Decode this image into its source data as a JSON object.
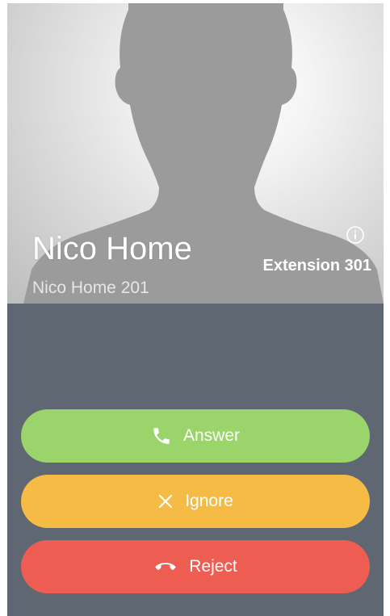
{
  "caller": {
    "name": "Nico Home",
    "subtitle": "Nico Home 201",
    "extension": "Extension 301"
  },
  "actions": {
    "answer_label": "Answer",
    "ignore_label": "Ignore",
    "reject_label": "Reject"
  },
  "icons": {
    "info": "info-icon",
    "answer": "phone-icon",
    "ignore": "close-icon",
    "reject": "hang-up-icon",
    "avatar": "person-silhouette"
  },
  "colors": {
    "panel": "#5f6772",
    "answer": "#9ad46b",
    "ignore": "#f5bb44",
    "reject": "#ee5d52"
  }
}
